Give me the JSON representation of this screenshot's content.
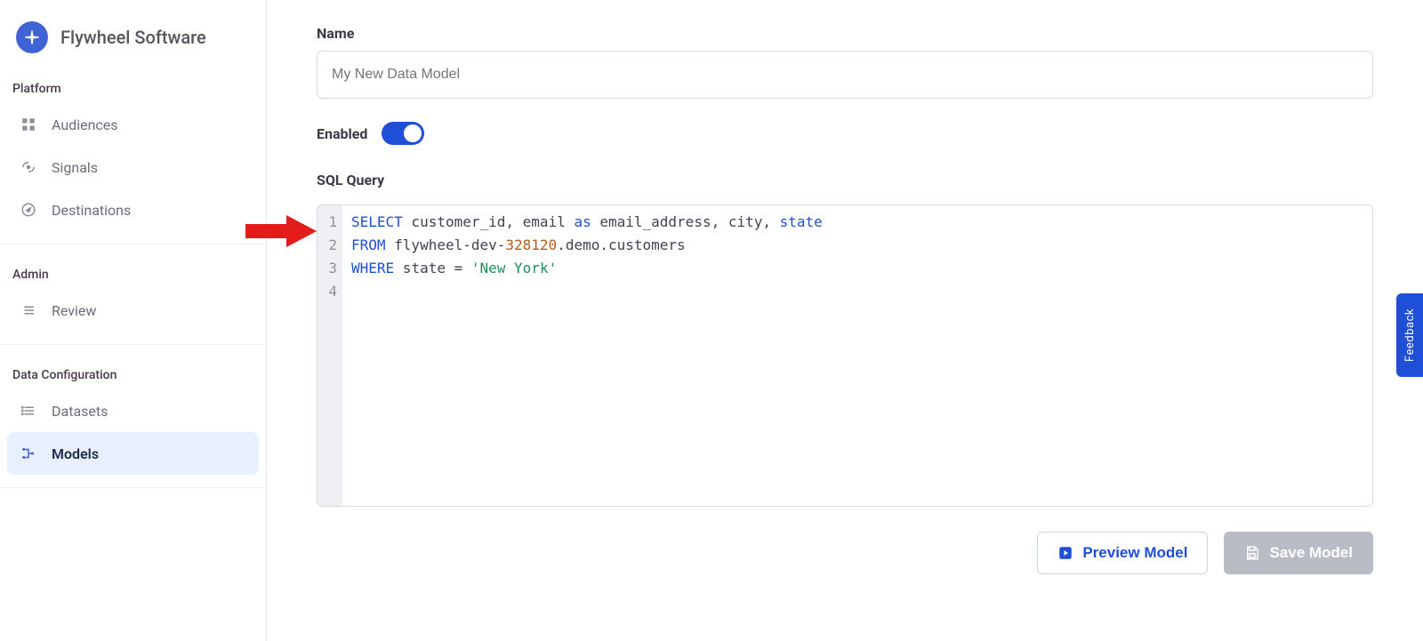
{
  "brand": {
    "name": "Flywheel Software"
  },
  "sidebar": {
    "sections": [
      {
        "header": "Platform",
        "items": [
          {
            "label": "Audiences",
            "icon": "grid"
          },
          {
            "label": "Signals",
            "icon": "signals"
          },
          {
            "label": "Destinations",
            "icon": "compass"
          }
        ]
      },
      {
        "header": "Admin",
        "items": [
          {
            "label": "Review",
            "icon": "list"
          }
        ]
      },
      {
        "header": "Data Configuration",
        "items": [
          {
            "label": "Datasets",
            "icon": "list"
          },
          {
            "label": "Models",
            "icon": "models",
            "active": true
          }
        ]
      }
    ]
  },
  "form": {
    "name_label": "Name",
    "name_placeholder": "My New Data Model",
    "name_value": "",
    "enabled_label": "Enabled",
    "enabled": true,
    "sql_label": "SQL Query",
    "sql_lines": [
      "1",
      "2",
      "3",
      "4"
    ],
    "sql": {
      "l1_kw1": "SELECT",
      "l1_rest1": " customer_id, email ",
      "l1_kw2": "as",
      "l1_rest2": " email_address, city, ",
      "l1_id": "state",
      "l2_kw": "FROM",
      "l2_mid": " flywheel-dev-",
      "l2_num": "328120",
      "l2_rest": ".demo.customers",
      "l3_kw": "WHERE",
      "l3_mid": " state = ",
      "l3_str": "'New York'"
    }
  },
  "buttons": {
    "preview": "Preview Model",
    "save": "Save Model"
  },
  "feedback": {
    "label": "Feedback"
  },
  "annotation": {
    "arrow_color": "#e31b1b"
  }
}
